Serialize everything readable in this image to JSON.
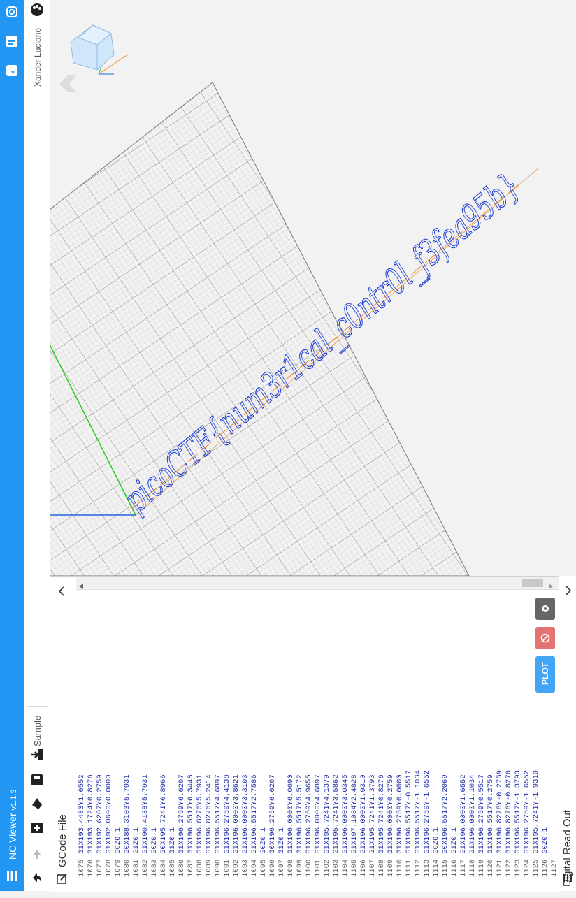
{
  "app": {
    "title": "NC Viewer",
    "version": "v1.1.3"
  },
  "user": {
    "name": "Xander Luciano"
  },
  "toolbar": {
    "sample_label": "Sample"
  },
  "viewport": {
    "flag_text": "picoCTF{num3r1cal_c0ntr0l_f3fea95b}"
  },
  "gcode": {
    "title": "GCode File",
    "plot_label": "PLOT",
    "lines": [
      {
        "n": "1075",
        "t": "G1X193.4483Y1.6552"
      },
      {
        "n": "1076",
        "t": "G1X193.1724Y0.8276"
      },
      {
        "n": "1077",
        "t": "G1X192.6207Y0.2759"
      },
      {
        "n": "1078",
        "t": "G1X192.0690Y0.0000"
      },
      {
        "n": "1079",
        "t": "G0Z0.1"
      },
      {
        "n": "1080",
        "t": "G0X188.3103Y5.7931"
      },
      {
        "n": "1081",
        "t": "G1Z0.1"
      },
      {
        "n": "1082",
        "t": "G1X190.4138Y5.7931"
      },
      {
        "n": "1083",
        "t": "G0Z0.1"
      },
      {
        "n": "1084",
        "t": "G0X195.7241Y6.8966"
      },
      {
        "n": "1085",
        "t": "G1Z0.1"
      },
      {
        "n": "1086",
        "t": "G1X196.2759Y6.6207"
      },
      {
        "n": "1087",
        "t": "G1X196.5517Y6.3448"
      },
      {
        "n": "1088",
        "t": "G1X196.8276Y5.7931"
      },
      {
        "n": "1089",
        "t": "G1X196.8276Y5.2414"
      },
      {
        "n": "1090",
        "t": "G1X196.5517Y4.6897"
      },
      {
        "n": "1091",
        "t": "G1X196.2759Y4.4138"
      },
      {
        "n": "1092",
        "t": "G1X196.0000Y3.8621"
      },
      {
        "n": "1093",
        "t": "G1X196.0000Y3.3103"
      },
      {
        "n": "1094",
        "t": "G1X196.5517Y2.7586"
      },
      {
        "n": "1095",
        "t": "G0Z0.1"
      },
      {
        "n": "1096",
        "t": "G0X196.2759Y6.6207"
      },
      {
        "n": "1097",
        "t": "G1Z0.1"
      },
      {
        "n": "1098",
        "t": "G1X196.0000Y6.0690"
      },
      {
        "n": "1099",
        "t": "G1X196.5517Y5.5172"
      },
      {
        "n": "1100",
        "t": "G1X196.2759Y4.9655"
      },
      {
        "n": "1101",
        "t": "G1X196.0000Y4.6897"
      },
      {
        "n": "1102",
        "t": "G1X195.7241Y4.1379"
      },
      {
        "n": "1103",
        "t": "G1X195.7241Y3.5862"
      },
      {
        "n": "1104",
        "t": "G1X196.0000Y3.0345"
      },
      {
        "n": "1105",
        "t": "G1X197.1034Y2.4828"
      },
      {
        "n": "1106",
        "t": "G1X196.0000Y1.9310"
      },
      {
        "n": "1107",
        "t": "G1X195.7241Y1.3793"
      },
      {
        "n": "1108",
        "t": "G1X195.7241Y0.8276"
      },
      {
        "n": "1109",
        "t": "G1X196.0000Y0.2759"
      },
      {
        "n": "1110",
        "t": "G1X196.2759Y0.0000"
      },
      {
        "n": "1111",
        "t": "G1X196.5517Y-0.5517"
      },
      {
        "n": "1112",
        "t": "G1X196.5517Y-1.1034"
      },
      {
        "n": "1113",
        "t": "G1X196.2759Y-1.6552"
      },
      {
        "n": "1114",
        "t": "G0Z0.1"
      },
      {
        "n": "1115",
        "t": "G0X196.5517Y2.2069"
      },
      {
        "n": "1116",
        "t": "G1Z0.1"
      },
      {
        "n": "1117",
        "t": "G1X196.0000Y1.6552"
      },
      {
        "n": "1118",
        "t": "G1X196.0000Y1.1034"
      },
      {
        "n": "1119",
        "t": "G1X196.2759Y0.5517"
      },
      {
        "n": "1120",
        "t": "G1X196.5517Y0.2759"
      },
      {
        "n": "1121",
        "t": "G1X196.8276Y-0.2759"
      },
      {
        "n": "1122",
        "t": "G1X196.8276Y-0.8276"
      },
      {
        "n": "1123",
        "t": "G1X196.5517Y-1.3793"
      },
      {
        "n": "1124",
        "t": "G1X196.2759Y-1.6552"
      },
      {
        "n": "1125",
        "t": "G1X195.7241Y-1.9310"
      },
      {
        "n": "1126",
        "t": "G0Z0.1"
      },
      {
        "n": "1127",
        "t": ""
      }
    ]
  },
  "dro": {
    "title": "Digital Read Out"
  },
  "colors": {
    "accent": "#2196f3",
    "code_text": "#1f2fa8",
    "toolpath": "#e8892b",
    "grid": "#9e9e9e"
  }
}
